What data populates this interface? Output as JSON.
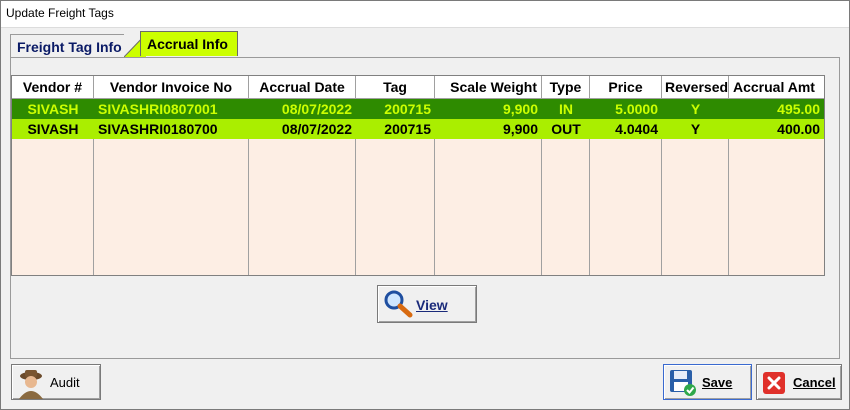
{
  "window": {
    "title": "Update Freight Tags"
  },
  "tabs": [
    {
      "label": "Freight Tag Info",
      "active": false
    },
    {
      "label": "Accrual Info",
      "active": true
    }
  ],
  "colors": {
    "selected_row_bg": "#2e8b00",
    "selected_row_text": "#ccff00",
    "row_bg": "#aaee00",
    "grid_bg": "#fdeee4",
    "active_tab": "#ccff00"
  },
  "grid": {
    "columns": [
      "Vendor #",
      "Vendor Invoice No",
      "Accrual Date",
      "Tag",
      "Scale Weight",
      "Type",
      "Price",
      "Reversed",
      "Accrual Amt"
    ],
    "rows": [
      {
        "vendor": "SIVASH",
        "invoice": "SIVASHRI0807001",
        "date": "08/07/2022",
        "tag": "200715",
        "weight": "9,900",
        "type": "IN",
        "price": "5.0000",
        "reversed": "Y",
        "amount": "495.00",
        "selected": true
      },
      {
        "vendor": "SIVASH",
        "invoice": "SIVASHRI0180700",
        "date": "08/07/2022",
        "tag": "200715",
        "weight": "9,900",
        "type": "OUT",
        "price": "4.0404",
        "reversed": "Y",
        "amount": "400.00",
        "selected": false
      }
    ]
  },
  "buttons": {
    "view": {
      "label": "View",
      "icon": "magnifier-icon"
    },
    "audit": {
      "label": "Audit",
      "icon": "detective-icon"
    },
    "save": {
      "label": "Save",
      "icon": "floppy-check-icon"
    },
    "cancel": {
      "label": "Cancel",
      "icon": "close-icon"
    }
  }
}
